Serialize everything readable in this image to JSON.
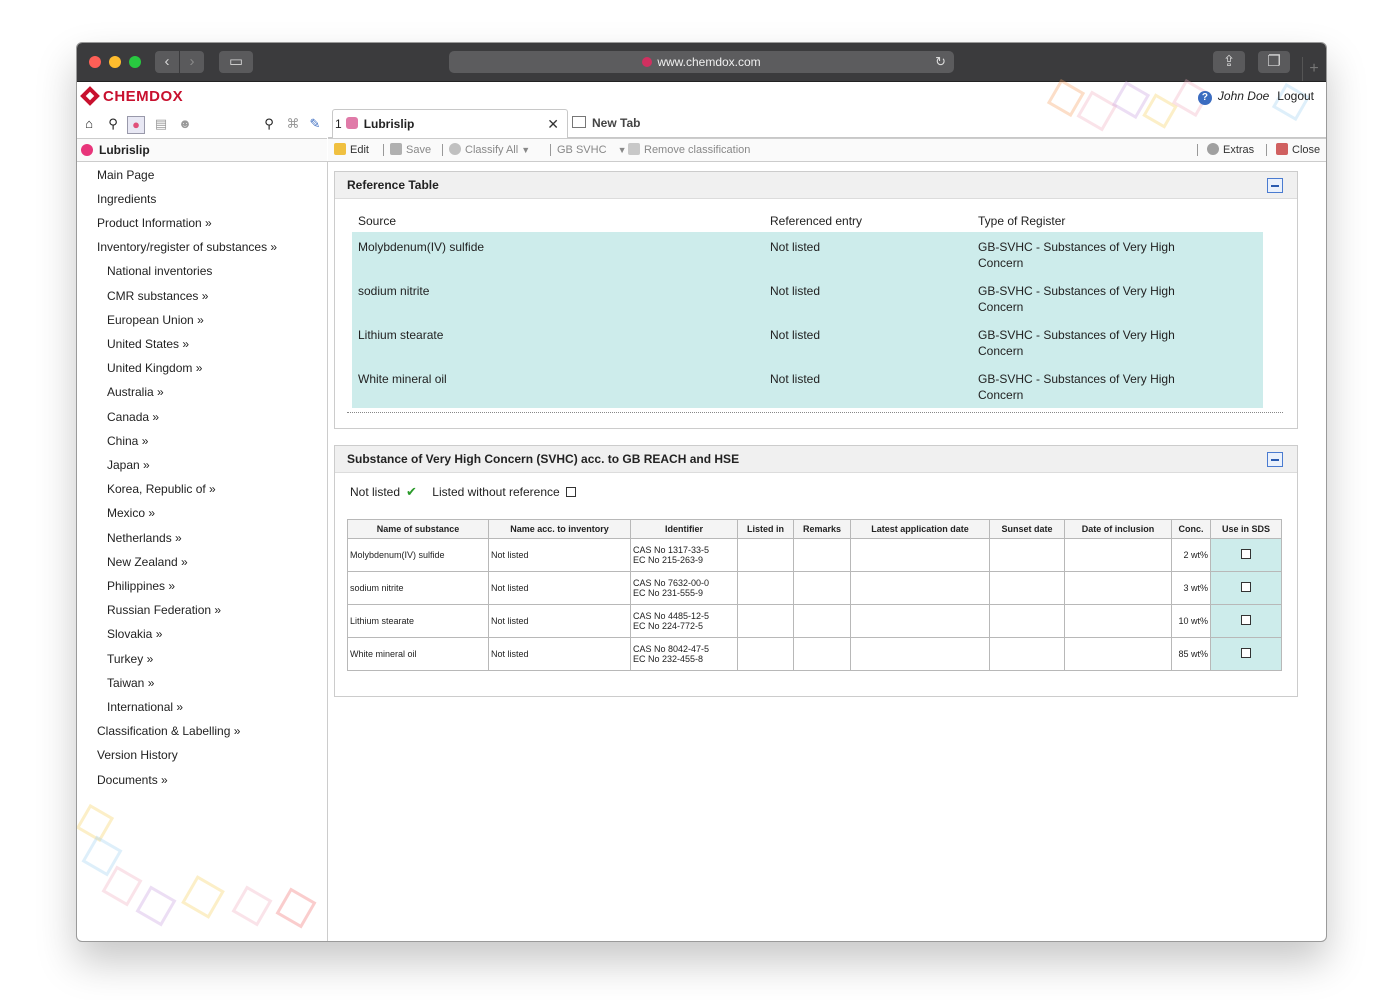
{
  "browser": {
    "url": "www.chemdox.com"
  },
  "app": {
    "logo": "CHEMDOX",
    "user": {
      "name": "John Doe",
      "logout": "Logout"
    }
  },
  "tabs": [
    {
      "num": "1",
      "label": "Lubrislip",
      "close": "✕"
    },
    {
      "label": "New Tab"
    }
  ],
  "breadcrumb": "Lubrislip",
  "toolbar": {
    "edit": "Edit",
    "save": "Save",
    "classify_all": "Classify All",
    "gb_svhc": "GB SVHC",
    "remove_classification": "Remove classification",
    "extras": "Extras",
    "close": "Close"
  },
  "nav": {
    "items": [
      "Main Page",
      "Ingredients",
      "Product Information »",
      "Inventory/register of substances »",
      "National inventories",
      "CMR substances »",
      "European Union »",
      "United States »",
      "United Kingdom »",
      "Australia »",
      "Canada »",
      "China »",
      "Japan »",
      "Korea, Republic of »",
      "Mexico »",
      "Netherlands »",
      "New Zealand »",
      "Philippines »",
      "Russian Federation »",
      "Slovakia »",
      "Turkey »",
      "Taiwan »",
      "International »",
      "Classification & Labelling »",
      "Version History",
      "Documents »"
    ]
  },
  "reference_table": {
    "title": "Reference Table",
    "headers": [
      "Source",
      "Referenced entry",
      "Type of Register"
    ],
    "rows": [
      {
        "source": "Molybdenum(IV) sulfide",
        "entry": "Not listed",
        "type1": "GB-SVHC - Substances of Very High",
        "type2": "Concern"
      },
      {
        "source": "sodium nitrite",
        "entry": "Not listed",
        "type1": "GB-SVHC - Substances of Very High",
        "type2": "Concern"
      },
      {
        "source": "Lithium stearate",
        "entry": "Not listed",
        "type1": "GB-SVHC - Substances of Very High",
        "type2": "Concern"
      },
      {
        "source": "White mineral oil",
        "entry": "Not listed",
        "type1": "GB-SVHC - Substances of Very High",
        "type2": "Concern"
      }
    ]
  },
  "svhc": {
    "title": "Substance of Very High Concern (SVHC) acc. to GB REACH and HSE",
    "legend_not_listed": "Not listed",
    "legend_without_ref": "Listed without reference",
    "headers": [
      "Name of substance",
      "Name acc. to inventory",
      "Identifier",
      "Listed in",
      "Remarks",
      "Latest application date",
      "Sunset date",
      "Date of inclusion",
      "Conc.",
      "Use in SDS"
    ],
    "rows": [
      {
        "name": "Molybdenum(IV) sulfide",
        "inv": "Not listed",
        "cas": "CAS No 1317-33-5",
        "ec": "EC No 215-263-9",
        "conc": "2 wt%"
      },
      {
        "name": "sodium nitrite",
        "inv": "Not listed",
        "cas": "CAS No 7632-00-0",
        "ec": "EC No 231-555-9",
        "conc": "3 wt%"
      },
      {
        "name": "Lithium stearate",
        "inv": "Not listed",
        "cas": "CAS No 4485-12-5",
        "ec": "EC No 224-772-5",
        "conc": "10 wt%"
      },
      {
        "name": "White mineral oil",
        "inv": "Not listed",
        "cas": "CAS No 8042-47-5",
        "ec": "EC No 232-455-8",
        "conc": "85 wt%"
      }
    ]
  },
  "colors": {
    "brand": "#c8102e",
    "highlight": "#cdeceb",
    "accent": "#3b6cc0"
  }
}
